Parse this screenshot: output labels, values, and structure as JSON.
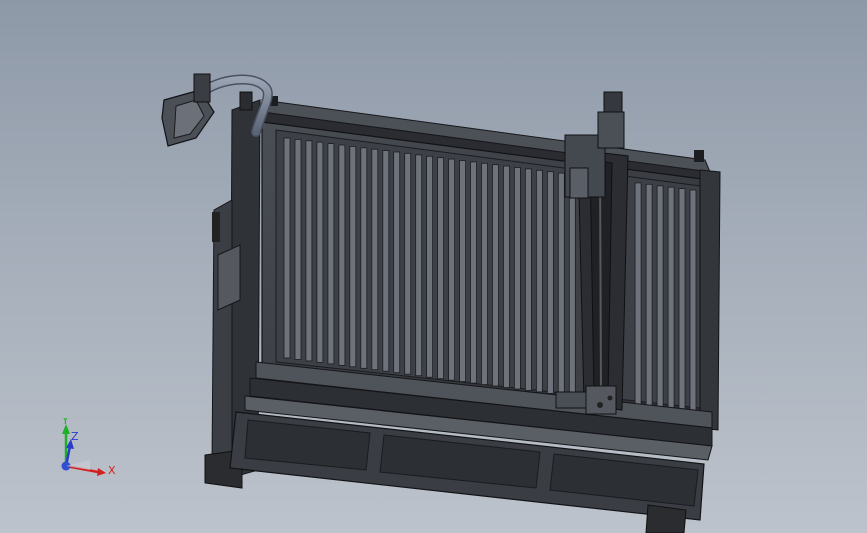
{
  "viewport": {
    "background_top": "#8e99a8",
    "background_bottom": "#bdc3cc"
  },
  "model": {
    "body_color": "#3a3d42",
    "edge_color": "#1b1c1f",
    "hose_color": "#7d8799"
  },
  "triad": {
    "x_label": "X",
    "y_label": "Y",
    "z_label": "Z",
    "x_color": "#d22020",
    "y_color": "#1fb02a",
    "z_color": "#2a3cc8"
  }
}
